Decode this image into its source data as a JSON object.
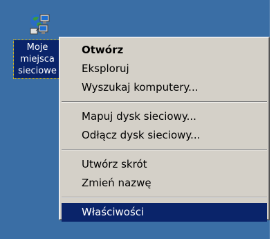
{
  "desktop": {
    "icon": {
      "icon_name": "network-places-icon",
      "label_lines": [
        "Moje",
        "miejsca",
        "sieciowe"
      ]
    }
  },
  "context_menu": {
    "groups": [
      [
        {
          "label": "Otwórz",
          "bold": true
        },
        {
          "label": "Eksploruj"
        },
        {
          "label": "Wyszukaj komputery..."
        }
      ],
      [
        {
          "label": "Mapuj dysk sieciowy..."
        },
        {
          "label": "Odłącz dysk sieciowy..."
        }
      ],
      [
        {
          "label": "Utwórz skrót"
        },
        {
          "label": "Zmień nazwę"
        }
      ],
      [
        {
          "label": "Właściwości",
          "selected": true
        }
      ]
    ]
  },
  "colors": {
    "desktop_bg": "#3a6ea5",
    "menu_bg": "#d4d0c8",
    "selection": "#0a246a"
  }
}
